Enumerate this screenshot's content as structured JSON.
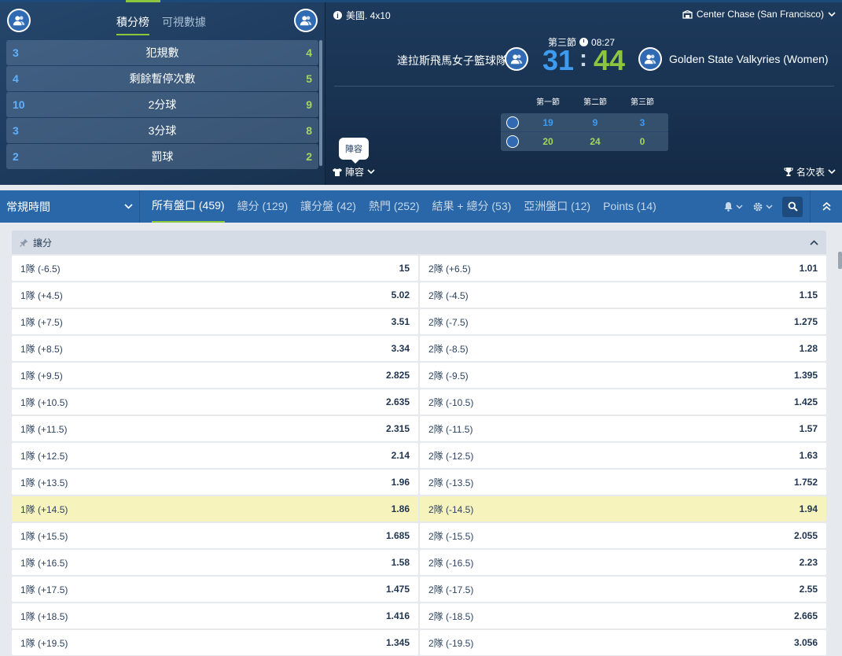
{
  "stats_panel": {
    "tabs": [
      {
        "label": "積分榜",
        "active": true
      },
      {
        "label": "可視數據",
        "active": false
      }
    ],
    "rows": [
      {
        "home": "3",
        "label": "犯規數",
        "away": "4"
      },
      {
        "home": "4",
        "label": "剩餘暫停次數",
        "away": "5"
      },
      {
        "home": "10",
        "label": "2分球",
        "away": "9"
      },
      {
        "home": "3",
        "label": "3分球",
        "away": "8"
      },
      {
        "home": "2",
        "label": "罰球",
        "away": "2"
      }
    ]
  },
  "match": {
    "league": "美國. 4x10",
    "venue": "Center Chase (San Francisco)",
    "period": "第三節",
    "clock": "08:27",
    "home_team": "達拉斯飛馬女子籃球隊",
    "away_team": "Golden State Valkyries (Women)",
    "home_score": "31",
    "separator": ":",
    "away_score": "44",
    "period_headers": [
      "第一節",
      "第二節",
      "第三節"
    ],
    "home_periods": [
      "19",
      "9",
      "3"
    ],
    "away_periods": [
      "20",
      "24",
      "0"
    ],
    "tooltip": "陣容",
    "lineup_label": "陣容",
    "ranking_label": "名次表"
  },
  "tabbar": {
    "period_select": "常規時間",
    "tabs": [
      {
        "label": "所有盤口 (459)",
        "active": true
      },
      {
        "label": "總分 (129)",
        "active": false
      },
      {
        "label": "讓分盤 (42)",
        "active": false
      },
      {
        "label": "熱門 (252)",
        "active": false
      },
      {
        "label": "結果 + 總分 (53)",
        "active": false
      },
      {
        "label": "亞洲盤口 (12)",
        "active": false
      },
      {
        "label": "Points (14)",
        "active": false
      }
    ]
  },
  "market": {
    "title": "讓分",
    "rows": [
      {
        "l_label": "1隊 (-6.5)",
        "l_odd": "15",
        "r_label": "2隊 (+6.5)",
        "r_odd": "1.01"
      },
      {
        "l_label": "1隊 (+4.5)",
        "l_odd": "5.02",
        "r_label": "2隊 (-4.5)",
        "r_odd": "1.15"
      },
      {
        "l_label": "1隊 (+7.5)",
        "l_odd": "3.51",
        "r_label": "2隊 (-7.5)",
        "r_odd": "1.275"
      },
      {
        "l_label": "1隊 (+8.5)",
        "l_odd": "3.34",
        "r_label": "2隊 (-8.5)",
        "r_odd": "1.28"
      },
      {
        "l_label": "1隊 (+9.5)",
        "l_odd": "2.825",
        "r_label": "2隊 (-9.5)",
        "r_odd": "1.395"
      },
      {
        "l_label": "1隊 (+10.5)",
        "l_odd": "2.635",
        "r_label": "2隊 (-10.5)",
        "r_odd": "1.425"
      },
      {
        "l_label": "1隊 (+11.5)",
        "l_odd": "2.315",
        "r_label": "2隊 (-11.5)",
        "r_odd": "1.57"
      },
      {
        "l_label": "1隊 (+12.5)",
        "l_odd": "2.14",
        "r_label": "2隊 (-12.5)",
        "r_odd": "1.63"
      },
      {
        "l_label": "1隊 (+13.5)",
        "l_odd": "1.96",
        "r_label": "2隊 (-13.5)",
        "r_odd": "1.752"
      },
      {
        "l_label": "1隊 (+14.5)",
        "l_odd": "1.86",
        "r_label": "2隊 (-14.5)",
        "r_odd": "1.94",
        "highlight": true
      },
      {
        "l_label": "1隊 (+15.5)",
        "l_odd": "1.685",
        "r_label": "2隊 (-15.5)",
        "r_odd": "2.055"
      },
      {
        "l_label": "1隊 (+16.5)",
        "l_odd": "1.58",
        "r_label": "2隊 (-16.5)",
        "r_odd": "2.23"
      },
      {
        "l_label": "1隊 (+17.5)",
        "l_odd": "1.475",
        "r_label": "2隊 (-17.5)",
        "r_odd": "2.55"
      },
      {
        "l_label": "1隊 (+18.5)",
        "l_odd": "1.416",
        "r_label": "2隊 (-18.5)",
        "r_odd": "2.665"
      },
      {
        "l_label": "1隊 (+19.5)",
        "l_odd": "1.345",
        "r_label": "2隊 (-19.5)",
        "r_odd": "3.056"
      }
    ]
  },
  "colors": {
    "accent_green": "#8cc63f",
    "home_blue": "#3d9cf0",
    "tabbar_blue": "#2a67a8",
    "highlight_yellow": "#f7f3bd"
  },
  "icons": [
    "team-avatar-icon",
    "info-icon",
    "stadium-icon",
    "clock-icon",
    "shirt-icon",
    "trophy-icon",
    "bell-icon",
    "gear-icon",
    "search-icon",
    "chevron-up-icon",
    "pin-icon"
  ]
}
